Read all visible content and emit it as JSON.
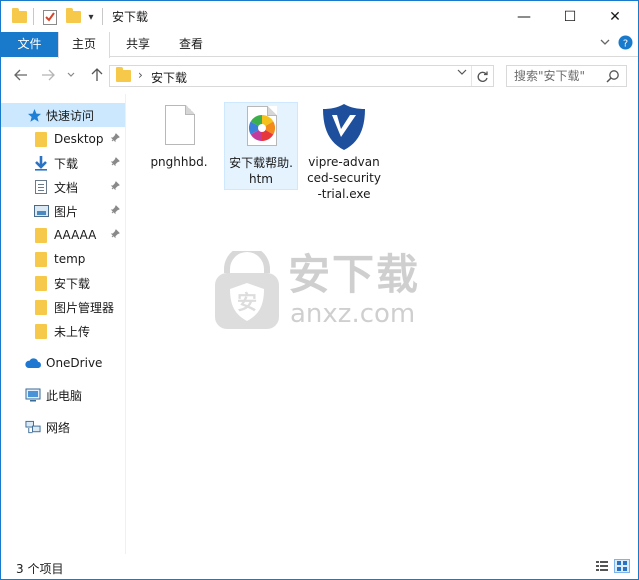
{
  "window": {
    "title": "安下载",
    "controls": {
      "minimize": "—",
      "maximize": "☐",
      "close": "✕"
    }
  },
  "ribbon": {
    "tabs": [
      {
        "label": "文件"
      },
      {
        "label": "主页"
      },
      {
        "label": "共享"
      },
      {
        "label": "查看"
      }
    ],
    "collapse_icon": "chevron-down-icon",
    "help_icon": "help-icon"
  },
  "address_bar": {
    "path": "安下载",
    "separator": "›"
  },
  "search": {
    "placeholder": "搜索\"安下载\""
  },
  "nav_pane": {
    "quick_access_label": "快速访问",
    "quick_items": [
      {
        "label": "Desktop",
        "icon": "folder-icon",
        "pinned": true
      },
      {
        "label": "下载",
        "icon": "download-arrow-icon",
        "pinned": true
      },
      {
        "label": "文档",
        "icon": "document-icon",
        "pinned": true
      },
      {
        "label": "图片",
        "icon": "picture-icon",
        "pinned": true
      },
      {
        "label": "AAAAA",
        "icon": "folder-icon",
        "pinned": true
      },
      {
        "label": "temp",
        "icon": "folder-icon",
        "pinned": false
      },
      {
        "label": "安下载",
        "icon": "folder-icon",
        "pinned": false
      },
      {
        "label": "图片管理器",
        "icon": "folder-icon",
        "pinned": false
      },
      {
        "label": "未上传",
        "icon": "folder-icon",
        "pinned": false
      }
    ],
    "onedrive_label": "OneDrive",
    "thispc_label": "此电脑",
    "network_label": "网络"
  },
  "files": [
    {
      "name": "pnghhbd.",
      "icon": "blank-file-icon",
      "selected": false
    },
    {
      "name": "安下载帮助.htm",
      "icon": "color-wheel-htm-icon",
      "selected": true
    },
    {
      "name": "vipre-advanced-security-trial.exe",
      "icon": "vipre-logo-icon",
      "selected": false
    }
  ],
  "watermark": {
    "title": "安下载",
    "subtitle": "anxz.com"
  },
  "status_bar": {
    "item_count": "3 个项目"
  },
  "colors": {
    "accent": "#1979ca",
    "selection": "#cce8ff",
    "folder": "#f6c94a",
    "vipre_blue": "#1e4f9c"
  }
}
